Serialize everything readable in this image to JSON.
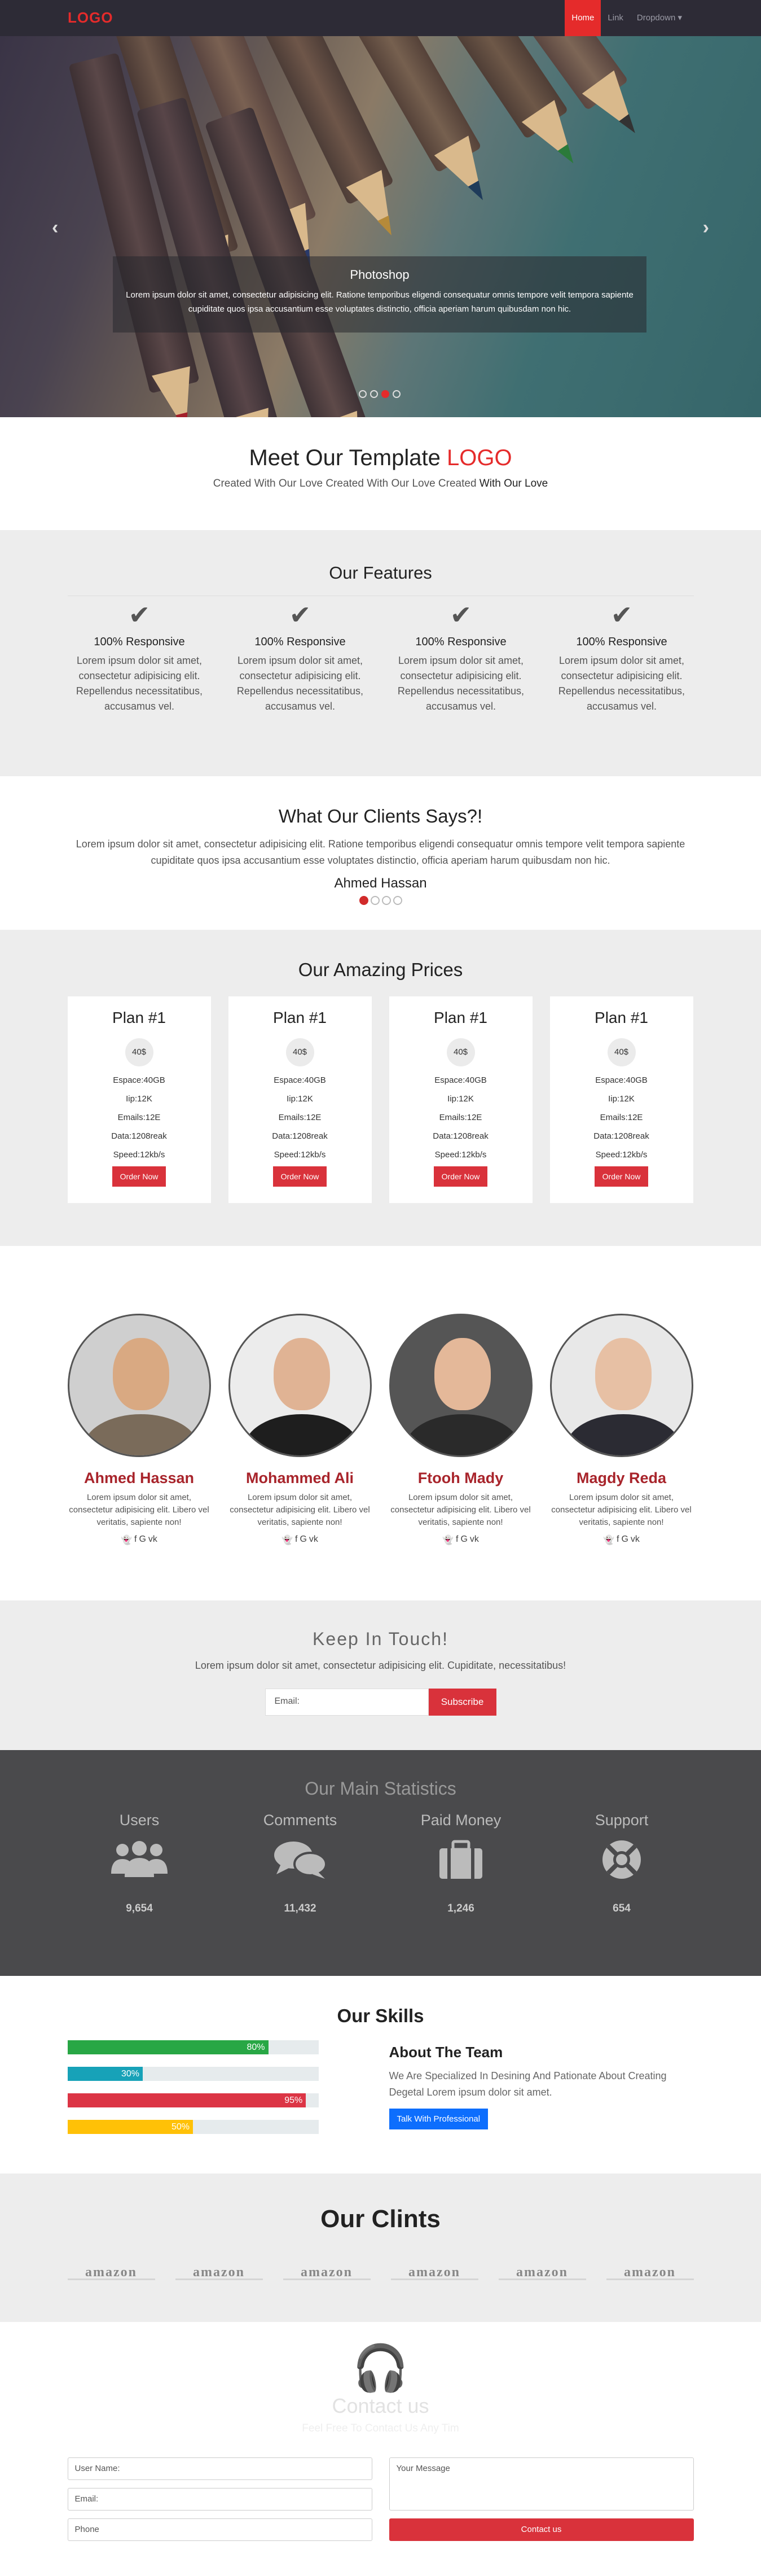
{
  "nav": {
    "logo": "LOGO",
    "links": [
      "Home",
      "Link",
      "Dropdown ▾"
    ]
  },
  "hero": {
    "caption_title": "Photoshop",
    "caption_text": "Lorem ipsum dolor sit amet, consectetur adipisicing elit. Ratione temporibus eligendi consequatur omnis tempore velit tempora sapiente cupiditate quos ipsa accusantium esse voluptates distinctio, officia aperiam harum quibusdam non hic.",
    "prev": "‹",
    "next": "›",
    "active_slide": 3
  },
  "meet": {
    "title_prefix": "Meet Our Template ",
    "title_accent": "LOGO",
    "subtitle": "Created With Our Love Created With Our Love Created ",
    "subtitle_bold": "With Our Love"
  },
  "features": {
    "title": "Our Features",
    "items": [
      {
        "icon": "check-icon",
        "title": "100% Responsive",
        "text": "Lorem ipsum dolor sit amet, consectetur adipisicing elit. Repellendus necessitatibus, accusamus vel."
      },
      {
        "icon": "check-icon",
        "title": "100% Responsive",
        "text": "Lorem ipsum dolor sit amet, consectetur adipisicing elit. Repellendus necessitatibus, accusamus vel."
      },
      {
        "icon": "check-icon",
        "title": "100% Responsive",
        "text": "Lorem ipsum dolor sit amet, consectetur adipisicing elit. Repellendus necessitatibus, accusamus vel."
      },
      {
        "icon": "check-icon",
        "title": "100% Responsive",
        "text": "Lorem ipsum dolor sit amet, consectetur adipisicing elit. Repellendus necessitatibus, accusamus vel."
      }
    ]
  },
  "clients": {
    "title": "What Our Clients Says?!",
    "quote": "Lorem ipsum dolor sit amet, consectetur adipisicing elit. Ratione temporibus eligendi consequatur omnis tempore velit tempora sapiente cupiditate quos ipsa accusantium esse voluptates distinctio, officia aperiam harum quibusdam non hic.",
    "author": "Ahmed Hassan"
  },
  "prices": {
    "title": "Our Amazing Prices",
    "plans": [
      {
        "name": "Plan #1",
        "price": "40$",
        "features": [
          "Espace:40GB",
          "Iip:12K",
          "Emails:12E",
          "Data:1208reak",
          "Speed:12kb/s"
        ],
        "button": "Order Now"
      },
      {
        "name": "Plan #1",
        "price": "40$",
        "features": [
          "Espace:40GB",
          "Iip:12K",
          "Emails:12E",
          "Data:1208reak",
          "Speed:12kb/s"
        ],
        "button": "Order Now"
      },
      {
        "name": "Plan #1",
        "price": "40$",
        "features": [
          "Espace:40GB",
          "Iip:12K",
          "Emails:12E",
          "Data:1208reak",
          "Speed:12kb/s"
        ],
        "button": "Order Now"
      },
      {
        "name": "Plan #1",
        "price": "40$",
        "features": [
          "Espace:40GB",
          "Iip:12K",
          "Emails:12E",
          "Data:1208reak",
          "Speed:12kb/s"
        ],
        "button": "Order Now"
      }
    ]
  },
  "team": [
    {
      "name": "Ahmed Hassan",
      "bio": "Lorem ipsum dolor sit amet, consectetur adipisicing elit. Libero vel veritatis, sapiente non!"
    },
    {
      "name": "Mohammed Ali",
      "bio": "Lorem ipsum dolor sit amet, consectetur adipisicing elit. Libero vel veritatis, sapiente non!"
    },
    {
      "name": "Ftooh Mady",
      "bio": "Lorem ipsum dolor sit amet, consectetur adipisicing elit. Libero vel veritatis, sapiente non!"
    },
    {
      "name": "Magdy Reda",
      "bio": "Lorem ipsum dolor sit amet, consectetur adipisicing elit. Libero vel veritatis, sapiente non!"
    }
  ],
  "team_social_icons": [
    "snapchat-icon",
    "facebook-icon",
    "google-icon",
    "vk-icon"
  ],
  "touch": {
    "title": "Keep In Touch!",
    "text": "Lorem ipsum dolor sit amet, consectetur adipisicing elit. Cupiditate, necessitatibus!",
    "email_placeholder": "Email:",
    "button": "Subscribe"
  },
  "stats": {
    "title": "Our Main Statistics",
    "items": [
      {
        "label": "Users",
        "icon": "users-icon",
        "value": "9,654"
      },
      {
        "label": "Comments",
        "icon": "comments-icon",
        "value": "11,432"
      },
      {
        "label": "Paid Money",
        "icon": "briefcase-icon",
        "value": "1,246"
      },
      {
        "label": "Support",
        "icon": "lifebuoy-icon",
        "value": "654"
      }
    ]
  },
  "skills": {
    "title": "Our Skills",
    "bars": [
      {
        "label": "80%",
        "value": 80,
        "color": "#28a745"
      },
      {
        "label": "30%",
        "value": 30,
        "color": "#17a2b8"
      },
      {
        "label": "95%",
        "value": 95,
        "color": "#dc3545"
      },
      {
        "label": "50%",
        "value": 50,
        "color": "#ffc107"
      }
    ],
    "about_title": "About The Team",
    "about_text": "We Are Specialized In Desining And Pationate About Creating Degetal Lorem ipsum dolor sit amet.",
    "about_button": "Talk With Professional"
  },
  "our_clints": {
    "title": "Our Clints",
    "brands": [
      "amazon",
      "amazon",
      "amazon",
      "amazon",
      "amazon",
      "amazon"
    ]
  },
  "contact": {
    "title": "Contact us",
    "subtitle": "Feel Free To Contact Us Any Tim",
    "username": "User Name:",
    "email": "Email:",
    "phone": "Phone",
    "message": "Your Message",
    "button": "Contact us"
  },
  "colors": {
    "accent": "#e52b2b",
    "nav_bg": "#2d2b36",
    "stats_bg": "#4a4a4c",
    "section_gray": "#ededed"
  }
}
